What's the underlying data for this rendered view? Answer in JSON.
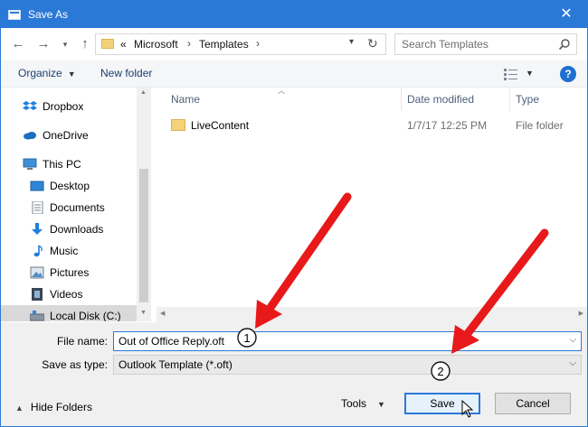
{
  "window": {
    "title": "Save As",
    "close_label": "✕"
  },
  "nav": {
    "breadcrumb": {
      "prefix": "«",
      "segments": [
        "Microsoft",
        "Templates"
      ]
    },
    "search": {
      "placeholder": "Search Templates"
    }
  },
  "toolbar": {
    "organize": "Organize",
    "new_folder": "New folder",
    "help": "?"
  },
  "sidebar": {
    "items": [
      {
        "label": "Dropbox",
        "icon": "dropbox-icon"
      },
      {
        "label": "OneDrive",
        "icon": "onedrive-icon"
      },
      {
        "label": "This PC",
        "icon": "pc-icon"
      },
      {
        "label": "Desktop",
        "icon": "desktop-icon"
      },
      {
        "label": "Documents",
        "icon": "documents-icon"
      },
      {
        "label": "Downloads",
        "icon": "downloads-icon"
      },
      {
        "label": "Music",
        "icon": "music-icon"
      },
      {
        "label": "Pictures",
        "icon": "pictures-icon"
      },
      {
        "label": "Videos",
        "icon": "videos-icon"
      },
      {
        "label": "Local Disk (C:)",
        "icon": "disk-icon"
      }
    ]
  },
  "files": {
    "columns": {
      "name": "Name",
      "date": "Date modified",
      "type": "Type"
    },
    "rows": [
      {
        "name": "LiveContent",
        "date": "1/7/17 12:25 PM",
        "type": "File folder"
      }
    ]
  },
  "form": {
    "file_name_label": "File name:",
    "file_name_value": "Out of Office Reply.oft",
    "save_type_label": "Save as type:",
    "save_type_value": "Outlook Template (*.oft)"
  },
  "footer": {
    "hide_folders": "Hide Folders",
    "tools": "Tools",
    "save": "Save",
    "cancel": "Cancel"
  },
  "annotations": {
    "callout_1": "1",
    "callout_2": "2",
    "arrow_color": "#e8191a"
  },
  "colors": {
    "accent": "#2b79d7",
    "link": "#1a3e72"
  }
}
